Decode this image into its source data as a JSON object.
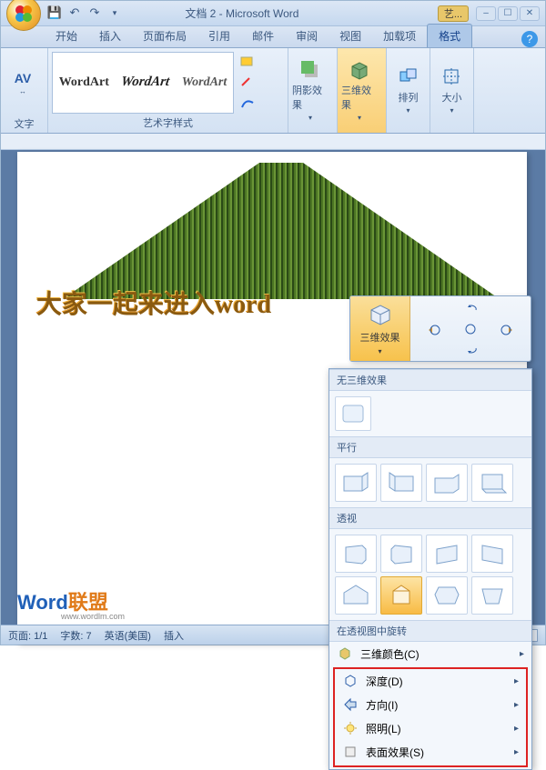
{
  "title": "文档 2 - Microsoft Word",
  "context_tab_chip": "艺...",
  "tabs": [
    "开始",
    "插入",
    "页面布局",
    "引用",
    "邮件",
    "审阅",
    "视图",
    "加载项",
    "格式"
  ],
  "active_tab_index": 8,
  "ribbon": {
    "spacing_btn": "AV",
    "text_group_label": "文字",
    "wordart_styles": [
      "WordArt",
      "WordArt",
      "WordArt"
    ],
    "wordart_group_label": "艺术字样式",
    "shadow_label": "阴影效果",
    "threeD_label": "三维效果",
    "arrange_label": "排列",
    "size_label": "大小"
  },
  "doc_wordart_text": "大家一起来进入word",
  "float_chunk_label": "三维效果",
  "dd": {
    "none_label": "无三维效果",
    "parallel_label": "平行",
    "perspective_label": "透视",
    "rotate_label": "在透视图中旋转",
    "menu_color": "三维颜色(C)",
    "menu_depth": "深度(D)",
    "menu_direction": "方向(I)",
    "menu_lighting": "照明(L)",
    "menu_surface": "表面效果(S)"
  },
  "statusbar": {
    "page": "页面: 1/1",
    "words": "字数: 7",
    "lang": "英语(美国)",
    "mode": "插入"
  },
  "watermark": {
    "brand": "Word",
    "suffix": "联盟",
    "url": "www.wordlm.com"
  }
}
